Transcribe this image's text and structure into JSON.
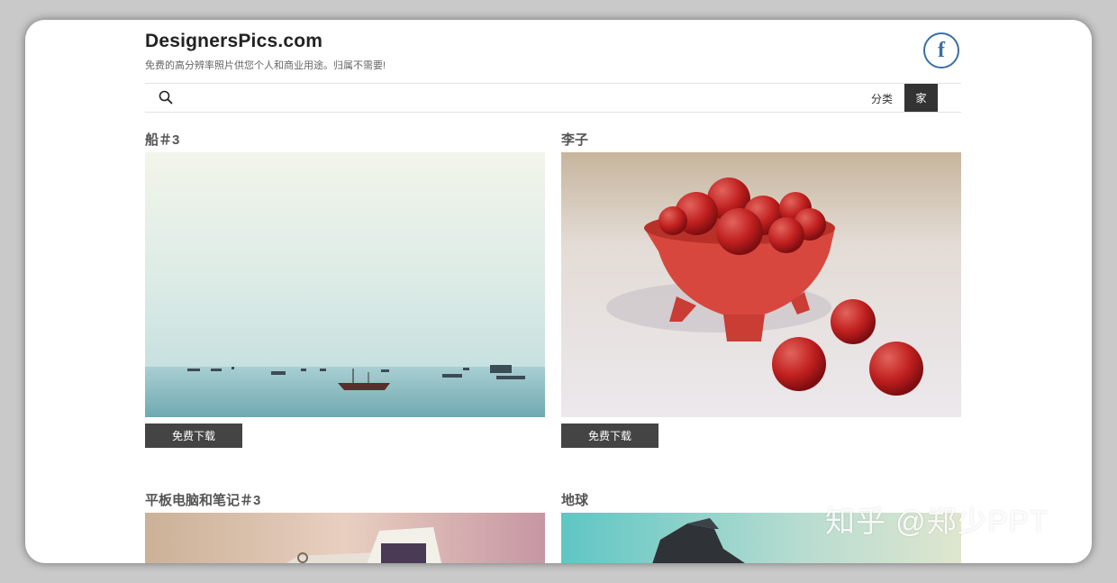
{
  "header": {
    "site_title": "DesignersPics.com",
    "tagline": "免费的高分辨率照片供您个人和商业用途。归属不需要!",
    "facebook_icon": "facebook-icon"
  },
  "nav": {
    "search_icon": "search-icon",
    "categories_label": "分类",
    "home_label": "家"
  },
  "cards": [
    {
      "title": "船＃3",
      "button_label": "免费下载"
    },
    {
      "title": "李子",
      "button_label": "免费下载"
    },
    {
      "title": "平板电脑和笔记＃3"
    },
    {
      "title": "地球"
    }
  ],
  "watermark": "知乎 @郑少PPT"
}
